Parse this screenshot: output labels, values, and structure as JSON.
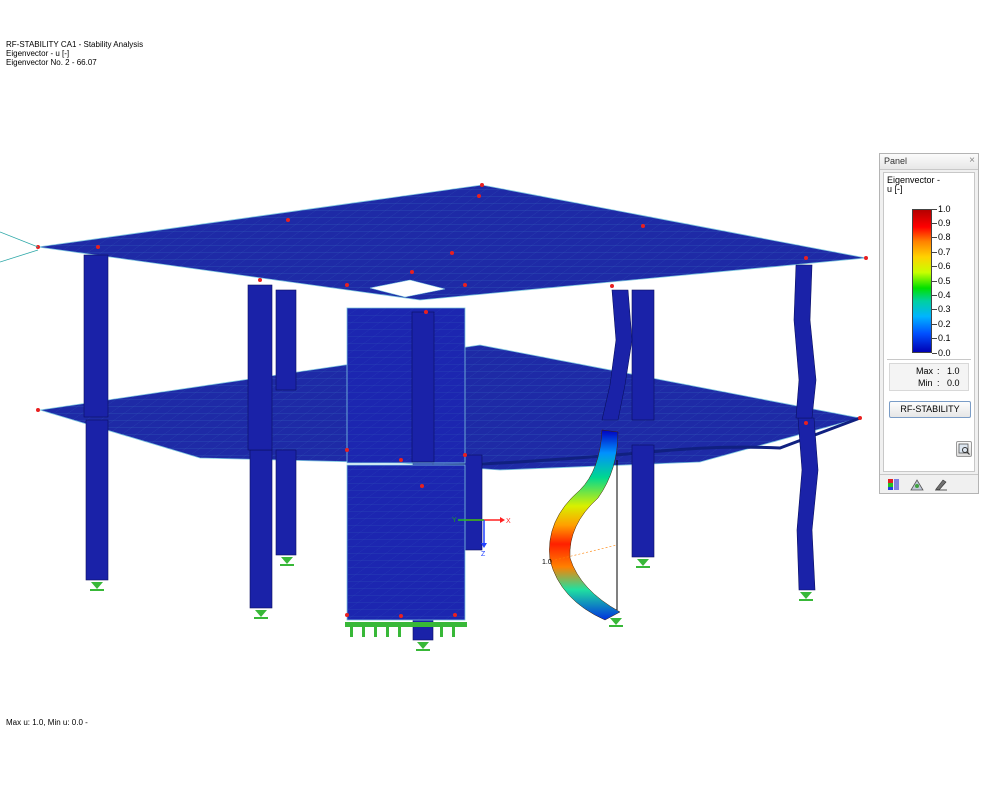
{
  "header": {
    "line1": "RF-STABILITY CA1 - Stability Analysis",
    "line2": "Eigenvector - u [-]",
    "line3": "Eigenvector No. 2  -  66.07"
  },
  "footer": {
    "text": "Max u: 1.0, Min u: 0.0 -"
  },
  "axes": {
    "x": "X",
    "y": "Y",
    "z": "Z"
  },
  "annotation": {
    "peak_value": "1.0"
  },
  "panel": {
    "title": "Panel",
    "close": "×",
    "heading_line1": "Eigenvector -",
    "heading_line2": "u [-]",
    "legend_labels": [
      "1.0",
      "0.9",
      "0.8",
      "0.7",
      "0.6",
      "0.5",
      "0.4",
      "0.3",
      "0.2",
      "0.1",
      "0.0"
    ],
    "max_label": "Max",
    "min_label": "Min",
    "colon": ":",
    "max_value": "1.0",
    "min_value": "0.0",
    "button_label": "RF-STABILITY"
  },
  "colors": {
    "structure": "#1a22a0",
    "mesh_line": "#4fa8c8",
    "node": "#e82020",
    "support": "#38b838"
  },
  "icons": [
    "color-scale-icon",
    "results-icon",
    "pencil-icon",
    "zoom-view-icon"
  ]
}
